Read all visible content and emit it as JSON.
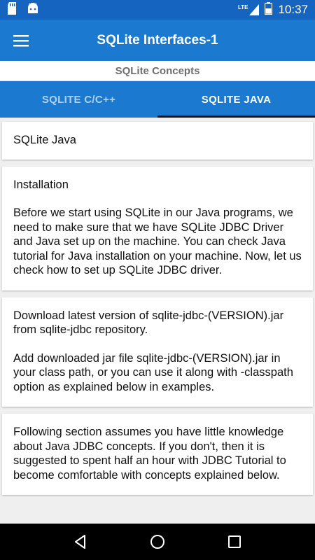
{
  "status_bar": {
    "time": "10:37",
    "network": "LTE",
    "icons": [
      "sd-card-icon",
      "android-icon",
      "signal-icon",
      "battery-icon"
    ]
  },
  "app_bar": {
    "title": "SQLite Interfaces-1",
    "menu_icon": "hamburger-menu-icon"
  },
  "subheader": {
    "text": "SQLite Concepts"
  },
  "tabs": [
    {
      "label": "SQLITE C/C++",
      "active": false
    },
    {
      "label": "SQLITE JAVA",
      "active": true
    }
  ],
  "cards": [
    {
      "paragraphs": [
        "SQLite Java"
      ]
    },
    {
      "paragraphs": [
        "Installation",
        "Before we start using SQLite in our Java programs, we need to make sure that we have SQLite JDBC Driver and Java set up on the machine. You can check Java tutorial for Java installation on your machine. Now, let us check how to set up SQLite JDBC driver."
      ]
    },
    {
      "paragraphs": [
        "Download latest version of sqlite-jdbc-(VERSION).jar from sqlite-jdbc repository.",
        "Add downloaded jar file sqlite-jdbc-(VERSION).jar in your class path, or you can use it along with -classpath option as explained below in examples."
      ]
    },
    {
      "paragraphs": [
        "Following section assumes you have little knowledge about Java JDBC concepts. If you don't, then it is suggested to spent half an hour with JDBC Tutorial to become comfortable with concepts explained below."
      ]
    }
  ],
  "nav_bar": {
    "buttons": [
      "back-icon",
      "home-icon",
      "recents-icon"
    ]
  },
  "colors": {
    "primary": "#1b7ad0",
    "status_bar": "#1565c0",
    "tab_indicator": "#111111",
    "background": "#efefef"
  }
}
